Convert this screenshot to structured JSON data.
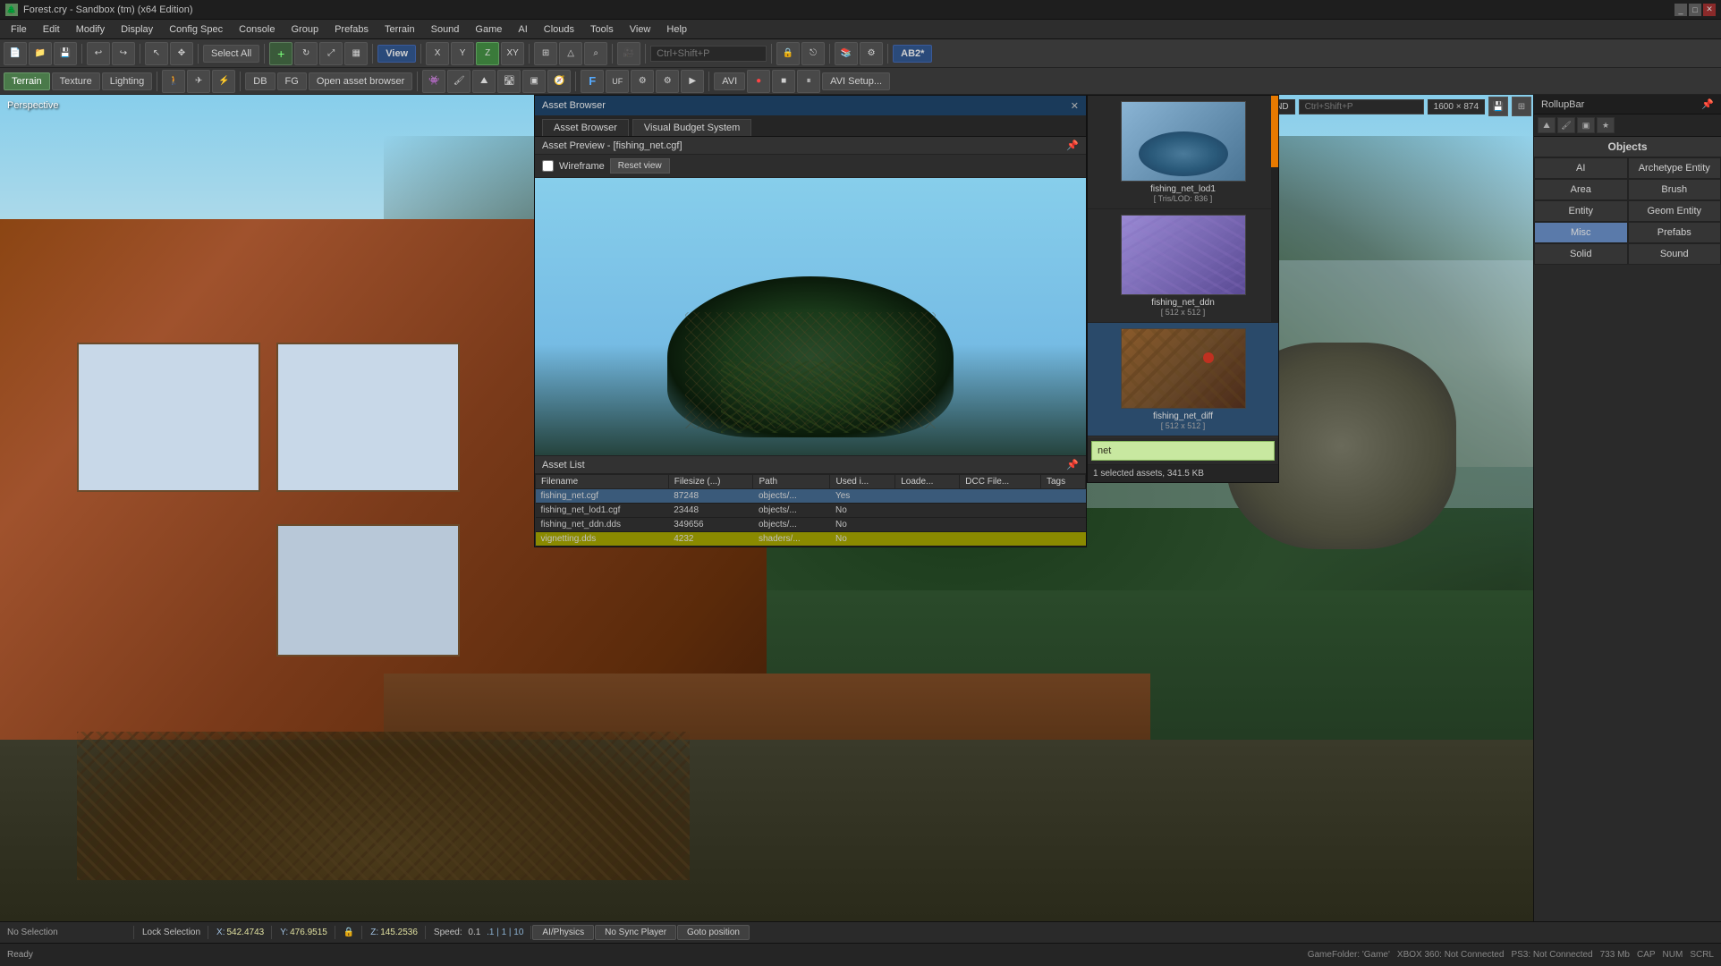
{
  "window": {
    "title": "Forest.cry - Sandbox (tm) (x64 Edition)",
    "icon": "🌲"
  },
  "menu": {
    "items": [
      "File",
      "Edit",
      "Modify",
      "Display",
      "Config Spec",
      "Console",
      "Group",
      "Prefabs",
      "Terrain",
      "Sound",
      "Game",
      "AI",
      "Clouds",
      "Tools",
      "View",
      "Help"
    ]
  },
  "toolbar1": {
    "select_all_label": "Select All",
    "view_label": "View",
    "z_label": "Z",
    "ab2_label": "AB2*",
    "xy_label": "XY"
  },
  "toolbar2": {
    "terrain_label": "Terrain",
    "texture_label": "Texture",
    "lighting_label": "Lighting",
    "db_label": "DB",
    "fg_label": "FG",
    "open_asset_label": "Open asset browser",
    "avi_label": "AVI",
    "avi_setup_label": "AVI Setup..."
  },
  "viewport": {
    "label": "Perspective",
    "filter_label": "By Name, Hide filtered, AND",
    "filter_placeholder": "Ctrl+Shift+P",
    "size_label": "1600 × 874"
  },
  "rollupbar": {
    "title": "RollupBar",
    "objects_label": "Objects",
    "buttons": [
      {
        "label": "AI",
        "col": 0,
        "row": 0
      },
      {
        "label": "Archetype Entity",
        "col": 1,
        "row": 0
      },
      {
        "label": "Area",
        "col": 0,
        "row": 1
      },
      {
        "label": "Brush",
        "col": 1,
        "row": 1
      },
      {
        "label": "Entity",
        "col": 0,
        "row": 2
      },
      {
        "label": "Geom Entity",
        "col": 1,
        "row": 2
      },
      {
        "label": "Misc",
        "col": 0,
        "row": 3,
        "active": true
      },
      {
        "label": "Prefabs",
        "col": 1,
        "row": 3
      },
      {
        "label": "Solid",
        "col": 0,
        "row": 4
      },
      {
        "label": "Sound",
        "col": 1,
        "row": 4
      }
    ]
  },
  "asset_browser": {
    "title": "Asset Browser",
    "tabs": [
      "Asset Browser",
      "Visual Budget System"
    ],
    "active_tab": "Asset Browser",
    "preview_title": "Asset Preview - [fishing_net.cgf]",
    "wireframe_label": "Wireframe",
    "reset_view_label": "Reset view",
    "list_title": "Asset List",
    "table_headers": [
      "Filename",
      "Filesize (...)",
      "Path",
      "Used i...",
      "Loade...",
      "DCC File...",
      "Tags"
    ],
    "table_rows": [
      {
        "filename": "fishing_net.cgf",
        "filesize": "87248",
        "path": "objects/...",
        "used": "Yes",
        "loaded": "",
        "dcc": "",
        "tags": "",
        "selected": true
      },
      {
        "filename": "fishing_net_lod1.cgf",
        "filesize": "23448",
        "path": "objects/...",
        "used": "No",
        "loaded": "",
        "dcc": "",
        "tags": ""
      },
      {
        "filename": "fishing_net_ddn.dds",
        "filesize": "349656",
        "path": "objects/...",
        "used": "No",
        "loaded": "",
        "dcc": "",
        "tags": ""
      },
      {
        "filename": "vignetting.dds",
        "filesize": "4232",
        "path": "shaders/...",
        "used": "No",
        "loaded": "",
        "dcc": "",
        "tags": "",
        "highlight": true
      }
    ]
  },
  "thumbnails": [
    {
      "label": "fishing_net_lod1",
      "sub": "[ Tris/LOD: 836 ]",
      "type": "lod1"
    },
    {
      "label": "fishing_net_ddn",
      "sub": "[ 512 x 512 ]",
      "type": "ddn"
    },
    {
      "label": "fishing_net_diff",
      "sub": "[ 512 x 512 ]",
      "type": "diff",
      "active": true
    }
  ],
  "search": {
    "value": "net",
    "result_info": "1 selected assets, 341.5 KB"
  },
  "status_bar": {
    "no_selection": "No Selection",
    "lock_selection": "Lock Selection",
    "x_label": "X:",
    "x_value": "542.4743",
    "y_label": "Y:",
    "y_value": "476.9515",
    "z_label": "Z:",
    "z_value": "145.2536",
    "speed_label": "Speed:",
    "speed_value": "0.1",
    "speed_vals": ".1 | 1 | 10",
    "ai_physics_btn": "AI/Physics",
    "no_sync_btn": "No Sync Player",
    "goto_btn": "Goto position"
  },
  "bottom_bar": {
    "ready_label": "Ready",
    "game_folder": "GameFolder: 'Game'",
    "xbox_label": "XBOX 360: Not Connected",
    "ps3_label": "PS3: Not Connected",
    "memory": "733 Mb",
    "cap": "CAP",
    "num": "NUM",
    "scrl": "SCRL"
  }
}
